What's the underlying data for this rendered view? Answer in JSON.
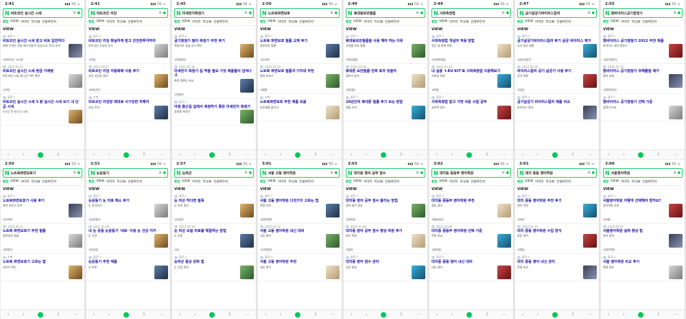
{
  "colors": {
    "brand": "#03c75a",
    "link": "#1a0dab"
  },
  "icons": {
    "logo": "naver-n-icon",
    "back": "back-arrow-icon",
    "forward": "forward-arrow-icon",
    "home": "home-icon",
    "share": "share-icon",
    "more": "more-icon"
  },
  "common": {
    "tabs": [
      "통합",
      "VIEW",
      "이미지",
      "지식iN",
      "인플루언서"
    ],
    "view_label": "VIEW",
    "more_label": "VIEW 더보기 →",
    "nav": [
      "‹",
      "›",
      "↻",
      "⇪",
      "⋯"
    ]
  },
  "phones": [
    {
      "time": "2:41",
      "query": "비트코인 실시간 시세",
      "items": [
        {
          "meta": "블로그",
          "title": "비트코인 실시간 시세 받고 버트 입찬하다",
          "text": "현재 가격은 전일 대비 변동이 있습니다. 투자 유의",
          "tags": [
            "#비트코인",
            "#시세"
          ]
        },
        {
          "meta": "2022.03.25",
          "title": "비트코인 실시간 시세 현금 거래량",
          "text": "비트코인 시세 24시간 차트 확인",
          "tags": [
            "#코인"
          ]
        },
        {
          "meta": "블로그",
          "title": "비트코인 실시간 시세 3 분 실시간 시세 보기 내 단 급 시세",
          "text": "1시간 전 실시간 시세",
          "tags": []
        }
      ]
    },
    {
      "time": "2:41",
      "query": "비트코인 리딩",
      "items": [
        {
          "meta": "블로그",
          "title": "비트코인 리딩 확실하게 받고 안전한투자하자",
          "text": "비트코인 리딩방 후기",
          "tags": [
            "#리딩"
          ]
        },
        {
          "meta": "2022.03.27",
          "title": "비트코인 리딩 자동매매 사용 후기",
          "text": "코인 리딩방 정리",
          "tags": [
            "#비트코인"
          ]
        },
        {
          "meta": "카페",
          "title": "비트코인 리딩방 제대로 사기당한 피해자",
          "text": "리딩 주의",
          "tags": []
        }
      ]
    },
    {
      "time": "2:45",
      "query": "미세먼지측정기",
      "items": [
        {
          "meta": "블로그",
          "title": "공기청정기 필터 측정기 추천 후기",
          "text": "측정기로 실내 공기 확인",
          "tags": [
            "#미세먼지"
          ]
        },
        {
          "meta": "2022.03.18",
          "title": "미세먼지 측정기 집 먹을 필요 거짓 제품들이 넘쳐나고",
          "text": "측정 정확도 비교",
          "tags": [
            "#측정기"
          ]
        },
        {
          "meta": "블로그",
          "title": "아침 출근길 집에서 측정하기 좋은 미세먼지 측정기",
          "text": "휴대용 측정기",
          "tags": []
        }
      ]
    },
    {
      "time": "2:50",
      "query": "노트북화면보호",
      "items": [
        {
          "meta": "블로그",
          "title": "노트북 화면보호 필름 교체 후기",
          "text": "정보보안 필름",
          "tags": [
            "#노트북"
          ]
        },
        {
          "meta": "2022.03.20",
          "title": "노트북 화면보호 필름과 거치대 추천",
          "text": "화면 보호기",
          "tags": [
            "#필름"
          ]
        },
        {
          "meta": "카페",
          "title": "노트북화면보호 추천 제품 모음",
          "text": "보호필름 붙이기",
          "tags": []
        }
      ]
    },
    {
      "time": "2:49",
      "query": "휴대용보안필름",
      "items": [
        {
          "meta": "블로그",
          "title": "휴대용보안필름을 사용 해야 하는 이유",
          "text": "사생활 보호 필름",
          "tags": [
            "#보안필름"
          ]
        },
        {
          "meta": "2022.03.24",
          "title": "휴대폰 보안필름 진짜 효과 있을까",
          "text": "엿보기 방지",
          "tags": [
            "#휴대폰"
          ]
        },
        {
          "meta": "블로그",
          "title": "20년간의 휴대폰 필름 후기 보는 방법",
          "text": "필름 추천",
          "tags": []
        }
      ]
    },
    {
      "time": "2:49",
      "query": "사회측정법",
      "items": [
        {
          "meta": "블로그",
          "title": "사회측정법 개념과 적용 방법",
          "text": "집단 내 관계 측정",
          "tags": [
            "#사회측정법"
          ]
        },
        {
          "meta": "2022.03.22",
          "title": "내 실용 'I-EU KIT'로 사회측정법 이용해보기",
          "text": "사회성 측정",
          "tags": [
            "#측정"
          ]
        },
        {
          "meta": "블로그",
          "title": "사회측정법 알고 가면 쉬운 시험 공부",
          "text": "교육학 정리",
          "tags": []
        }
      ]
    },
    {
      "time": "2:47",
      "query": "공기살균기바이러스킬러",
      "items": [
        {
          "meta": "블로그",
          "title": "공기살균기바이러스킬러 후기 살균 바이러스 제거",
          "text": "공기 살균 제품",
          "tags": [
            "#공기살균기"
          ]
        },
        {
          "meta": "2022.03.16",
          "title": "바이러스킬러 공기 살균기 사용 후기",
          "text": "공기 정화",
          "tags": [
            "#살균"
          ]
        },
        {
          "meta": "블로그",
          "title": "공기살균기 바이러스킬러 제품 비교",
          "text": "바이러스 킬러",
          "tags": []
        }
      ]
    },
    {
      "time": "2:55",
      "query": "항바이러스공기청정기",
      "items": [
        {
          "meta": "블로그",
          "title": "항바이러스 공기청정기 2022 추천 제품",
          "text": "바이러스 제거 청정기",
          "tags": [
            "#공기청정기"
          ]
        },
        {
          "meta": "2022.03.14",
          "title": "항바이러스 공기청정기 유해물질 제거",
          "text": "필터 교체",
          "tags": [
            "#항바이러스"
          ]
        },
        {
          "meta": "블로그",
          "title": "항바이러스 공기청정기 선택 기준",
          "text": "청정기 비교",
          "tags": []
        }
      ]
    },
    {
      "time": "2:50",
      "query": "노트북화면보호기",
      "items": [
        {
          "meta": "블로그",
          "title": "노트북화면보호기 사용 후기",
          "text": "화면 보호기 부착",
          "tags": [
            "#노트북"
          ]
        },
        {
          "meta": "2022.03.11",
          "title": "노트북 화면보호기 추천 필름",
          "text": "정보보호 필름",
          "tags": [
            "#보호기"
          ]
        },
        {
          "meta": "카페",
          "title": "노트북 화면보호기 고르는 법",
          "text": "사이즈 확인",
          "tags": []
        }
      ]
    },
    {
      "time": "2:51",
      "query": "눈운동기",
      "items": [
        {
          "meta": "블로그",
          "title": "눈운동기 눈 피로 해소 후기",
          "text": "눈 마사지기",
          "tags": [
            "#눈운동기"
          ]
        },
        {
          "meta": "2022.03.20",
          "title": "내 눈 운동 눈운동기 '네트' 이용 눈 건강 지키",
          "text": "눈 건강",
          "tags": [
            "#눈건강"
          ]
        },
        {
          "meta": "블로그",
          "title": "눈운동기 추천 제품",
          "text": "눈 피로",
          "tags": []
        }
      ]
    },
    {
      "time": "2:57",
      "query": "눈피곤",
      "items": [
        {
          "meta": "블로그",
          "title": "눈 피곤 하다면 필독",
          "text": "눈 피로 원인",
          "tags": [
            "#눈피곤"
          ]
        },
        {
          "meta": "2022.03.19",
          "title": "눈 피곤 오늘 피로를 해결하는 방법",
          "text": "눈 운동",
          "tags": [
            "#눈"
          ]
        },
        {
          "meta": "블로그",
          "title": "눈피곤 증상 완화 팁",
          "text": "눈 건강 관리",
          "tags": []
        }
      ]
    },
    {
      "time": "3:01",
      "query": "서울 고등 영어학원",
      "items": [
        {
          "meta": "블로그",
          "title": "서울 고등 영어학원 다섯가지 고르는 법",
          "text": "학원 추천",
          "tags": [
            "#영어학원"
          ]
        },
        {
          "meta": "2022.03.12",
          "title": "서울 고등 영어학원 내신 대비",
          "text": "고등 영어",
          "tags": [
            "#고등영어"
          ]
        },
        {
          "meta": "블로그",
          "title": "서울 고등 영어학원 추천",
          "text": "내신 영어",
          "tags": []
        }
      ]
    },
    {
      "time": "3:03",
      "query": "대치동 영어 공부 점수",
      "items": [
        {
          "meta": "블로그",
          "title": "대치동 영어 공부 점수 올리는 방법",
          "text": "영어 점수 향상",
          "tags": [
            "#대치동"
          ]
        },
        {
          "meta": "2022.03.09",
          "title": "대치동 영어 공부 점수 향상 학원 후기",
          "text": "영어 학원",
          "tags": [
            "#영어"
          ]
        },
        {
          "meta": "블로그",
          "title": "대치동 영어 점수 관리",
          "text": "공부 방법",
          "tags": []
        }
      ]
    },
    {
      "time": "3:02",
      "query": "대치동 중등부 영어학원",
      "items": [
        {
          "meta": "블로그",
          "title": "대치동 중등부 영어학원 추천",
          "text": "중등 영어",
          "tags": [
            "#중등영어"
          ]
        },
        {
          "meta": "2022.03.08",
          "title": "대치동 중등부 영어학원 선택 기준",
          "text": "학원 비교",
          "tags": [
            "#대치동"
          ]
        },
        {
          "meta": "블로그",
          "title": "대치동 중등 영어 내신 대비",
          "text": "내신 관리",
          "tags": []
        }
      ]
    },
    {
      "time": "3:01",
      "query": "대치 중등 영어학원",
      "items": [
        {
          "meta": "블로그",
          "title": "대치 중등 영어학원 추천 후기",
          "text": "영어 학원",
          "tags": [
            "#대치"
          ]
        },
        {
          "meta": "2022.03.10",
          "title": "대치 중등 영어학원 수업 방식",
          "text": "중등 영어",
          "tags": [
            "#중등"
          ]
        },
        {
          "meta": "블로그",
          "title": "대치 중등 영어 내신 관리",
          "text": "학원 비교",
          "tags": []
        }
      ]
    },
    {
      "time": "3:00",
      "query": "서울영어학원",
      "items": [
        {
          "meta": "블로그",
          "title": "서울영어학원 어떻게 선택해야 할까요?",
          "text": "영어학원 추천",
          "tags": [
            "#서울"
          ]
        },
        {
          "meta": "2022.03.07",
          "title": "서울영어학원 실력 향상 팁",
          "text": "영어 실력",
          "tags": [
            "#영어학원"
          ]
        },
        {
          "meta": "블로그",
          "title": "서울 영어학원 비교 후기",
          "text": "학원 정보",
          "tags": []
        }
      ]
    }
  ]
}
